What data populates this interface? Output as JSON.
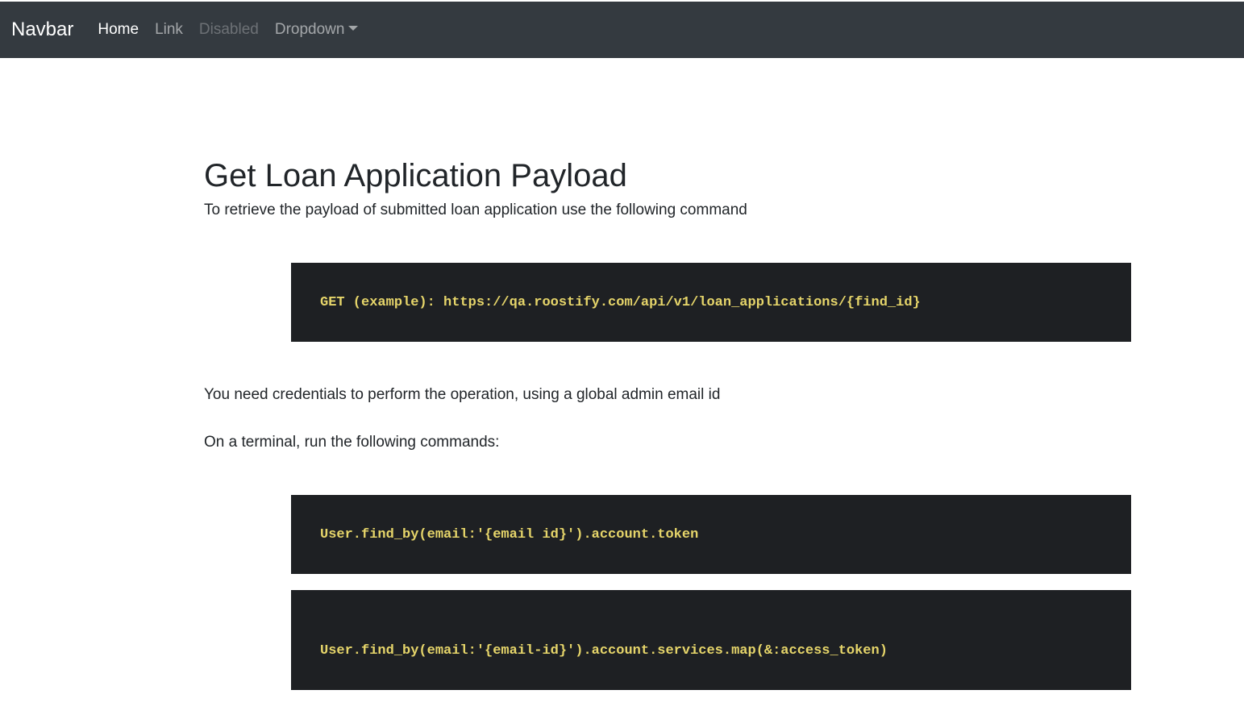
{
  "navbar": {
    "brand": "Navbar",
    "links": [
      {
        "label": "Home",
        "state": "active"
      },
      {
        "label": "Link",
        "state": "normal"
      },
      {
        "label": "Disabled",
        "state": "disabled"
      },
      {
        "label": "Dropdown",
        "state": "normal",
        "has_caret": true
      }
    ],
    "background": "#343a40"
  },
  "main": {
    "title": "Get Loan Application Payload",
    "intro": "To retrieve the payload of submitted loan application use the following command",
    "code1": "GET (example): https://qa.roostify.com/api/v1/loan_applications/{find_id}",
    "credentials_text": "You need credentials to perform the operation, using a global admin email id",
    "terminal_text": "On a terminal, run the following commands:",
    "code2": "User.find_by(email:'{email id}').account.token",
    "code3": "User.find_by(email:'{email-id}').account.services.map(&:access_token)",
    "code_background": "#1e2023",
    "code_color": "#e6d56a"
  }
}
